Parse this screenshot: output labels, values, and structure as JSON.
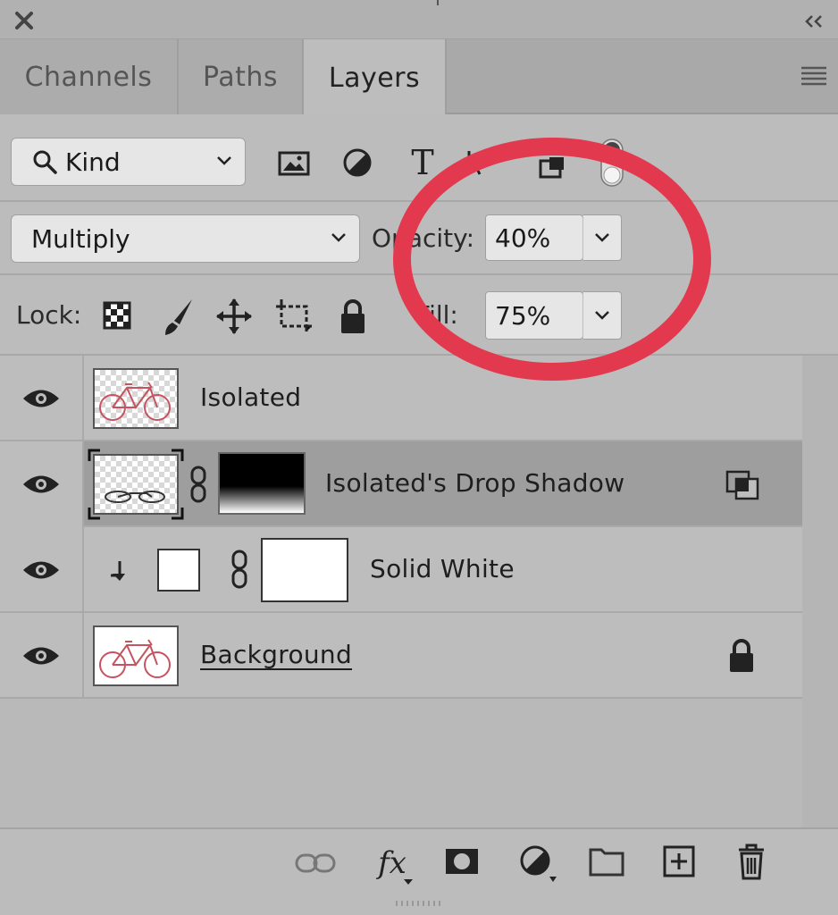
{
  "panel": {
    "close_glyph": "✕",
    "collapse_glyph": "‹‹",
    "tabs": [
      {
        "label": "Channels",
        "active": false
      },
      {
        "label": "Paths",
        "active": false
      },
      {
        "label": "Layers",
        "active": true
      }
    ]
  },
  "filter": {
    "kind_label": "Kind",
    "icons": [
      "image-filter-icon",
      "adjustment-filter-icon",
      "type-filter-icon",
      "shape-filter-icon",
      "smart-object-filter-icon",
      "filter-toggle-icon"
    ]
  },
  "blend": {
    "mode": "Multiply",
    "opacity_label": "Opacity:",
    "opacity_value": "40%",
    "fill_label": "Fill:",
    "fill_value": "75%"
  },
  "lock": {
    "label": "Lock:",
    "icons": [
      "lock-transparent-pixels-icon",
      "lock-image-pixels-icon",
      "lock-position-icon",
      "lock-artboard-icon",
      "lock-all-icon"
    ]
  },
  "layers": [
    {
      "name": "Isolated",
      "visible": true,
      "selected": false,
      "thumb": "bike-transparent"
    },
    {
      "name": "Isolated's Drop Shadow",
      "visible": true,
      "selected": true,
      "thumb": "shadow-transparent",
      "mask": "gradient"
    },
    {
      "name": "Solid White",
      "visible": true,
      "selected": false,
      "thumb": "white",
      "mask": "white",
      "clipped": true
    },
    {
      "name": "Background",
      "visible": true,
      "selected": false,
      "thumb": "bike-white",
      "locked": true
    }
  ],
  "bottom_icons": [
    "link-layers-icon",
    "fx-icon",
    "add-mask-icon",
    "adjustment-layer-icon",
    "new-group-icon",
    "new-layer-icon",
    "delete-layer-icon"
  ],
  "fx_label": "fx",
  "colors": {
    "panel_bg": "#bcbcbc",
    "selected_layer": "#9e9e9e",
    "annotation": "#e2394f"
  }
}
